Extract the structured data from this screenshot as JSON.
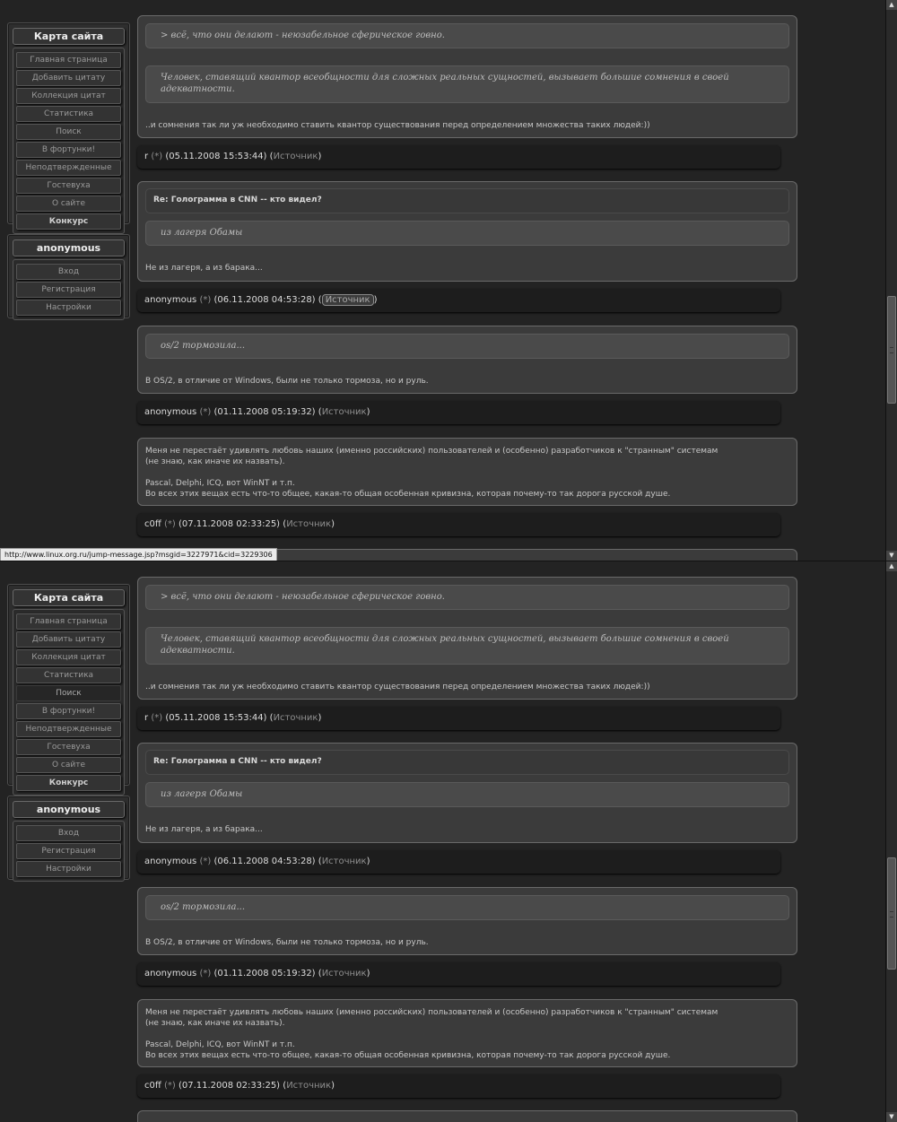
{
  "sidebar": {
    "map_title": "Карта сайта",
    "nav_items": [
      "Главная страница",
      "Добавить цитату",
      "Коллекция цитат",
      "Статистика",
      "Поиск",
      "В фортунки!",
      "Неподтвержденные",
      "Гостевуха",
      "О сайте",
      "Конкурс"
    ],
    "user_title": "anonymous",
    "user_items": [
      "Вход",
      "Регистрация",
      "Настройки"
    ]
  },
  "posts": [
    {
      "quote1": "> всё, что они делают - неюзабельное сферическое говно.",
      "quote2": "Человек, ставящий квантор всеобщности для сложных реальных сущностей, вызывает большие сомнения в своей адекватности.",
      "body": "..и сомнения так ли уж необходимо ставить квантор существования перед определением множества таких людей:))",
      "author": "r",
      "star": "(*)",
      "date": "(05.11.2008 15:53:44)",
      "source": "Источник"
    },
    {
      "title": "Re: Голограмма в CNN -- кто видел?",
      "quote1": "из лагеря Обамы",
      "body": "Не из лагеря, а из барака...",
      "author": "anonymous",
      "star": "(*)",
      "date": "(06.11.2008 04:53:28)",
      "source": "Источник"
    },
    {
      "quote1": "os/2 тормозила...",
      "body": "В OS/2, в отличие от Windows, были не только тормоза, но и руль.",
      "author": "anonymous",
      "star": "(*)",
      "date": "(01.11.2008 05:19:32)",
      "source": "Источник"
    },
    {
      "body_lines": [
        "Меня не перестаёт удивлять любовь наших (именно российских) пользователей и (особенно) разработчиков к \"странным\" системам",
        "(не знаю, как иначе их назвать).",
        "",
        "Pascal, Delphi, ICQ, вот WinNT и т.п.",
        "Во всех этих вещах есть что-то общее, какая-то общая особенная кривизна, которая почему-то так дорога русской душе."
      ],
      "author": "c0ff",
      "star": "(*)",
      "date": "(07.11.2008 02:33:25)",
      "source": "Источник"
    }
  ],
  "status_url": "http://www.linux.org.ru/jump-message.jsp?msgid=3227971&cid=3229306",
  "scrollbar": {
    "up_arrow": "▲",
    "down_arrow": "▼"
  }
}
